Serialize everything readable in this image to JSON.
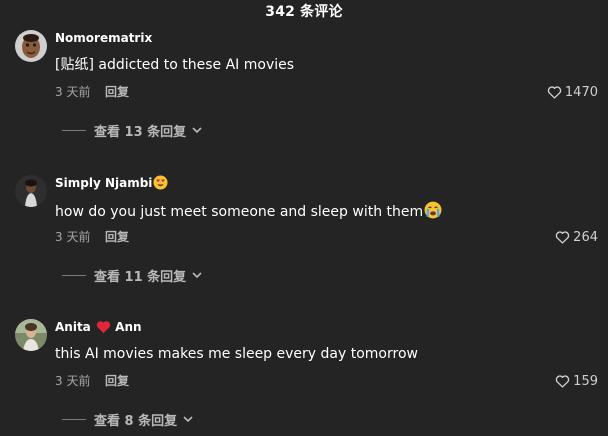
{
  "header": {
    "title": "342 条评论"
  },
  "comments": [
    {
      "username": "Nomorematrix",
      "text": "[贴纸] addicted to these AI movies",
      "time": "3 天前",
      "reply_label": "回复",
      "likes": "1470",
      "view_replies": "查看 13 条回复"
    },
    {
      "username": "Simply Njambi",
      "text": "how do you just meet someone and sleep with them",
      "time": "3 天前",
      "reply_label": "回复",
      "likes": "264",
      "view_replies": "查看 11 条回复"
    },
    {
      "username_parts": [
        "Anita",
        "Ann"
      ],
      "text": "this AI movies makes me sleep every day tomorrow",
      "time": "3 天前",
      "reply_label": "回复",
      "likes": "159",
      "view_replies": "查看 8 条回复"
    }
  ],
  "colors": {
    "background": "#242424",
    "text": "#ffffff",
    "muted": "#a6a6a6",
    "heart_emoji": "#e0263a"
  },
  "icons": [
    "heart-outline-icon",
    "chevron-down-icon",
    "heart-eyes-emoji",
    "crying-emoji",
    "red-heart-emoji"
  ]
}
